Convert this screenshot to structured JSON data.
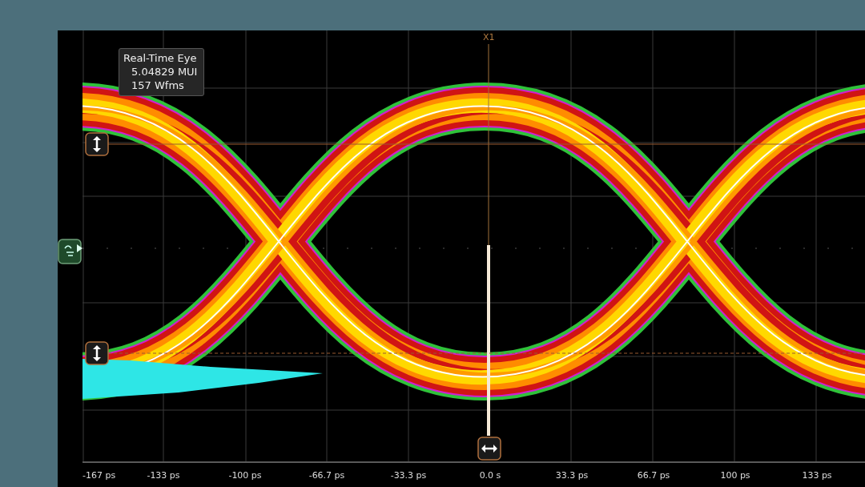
{
  "readout": {
    "lines": [
      "Real-Time Eye",
      "5.04829 MUI",
      "157 Wfms"
    ]
  },
  "cursor": {
    "label": "X1"
  },
  "x_axis": {
    "labels": [
      "-167 ps",
      "-133 ps",
      "-100 ps",
      "-66.7 ps",
      "-33.3 ps",
      "0.0 s",
      "33.3 ps",
      "66.7 ps",
      "100 ps",
      "133 ps"
    ]
  }
}
